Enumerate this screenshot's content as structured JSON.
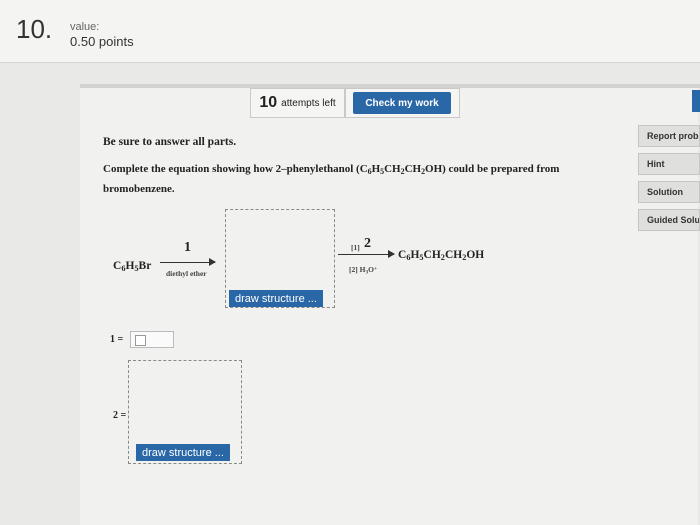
{
  "question": {
    "number": "10.",
    "value_label": "value:",
    "points": "0.50 points"
  },
  "toolbar": {
    "attempts_count": "10",
    "attempts_text": "attempts left",
    "check_label": "Check my work"
  },
  "side": {
    "report": "Report problem",
    "hint": "Hint",
    "solution": "Solution",
    "guided": "Guided Solution"
  },
  "instructions": {
    "line1": "Be sure to answer all parts.",
    "line2_a": "Complete the equation showing how 2–phenylethanol (C",
    "line2_b": "H",
    "line2_c": "CH",
    "line2_d": "CH",
    "line2_e": "OH) could be prepared from bromobenzene."
  },
  "reaction": {
    "reactant_c": "C",
    "reactant_h": "H",
    "reactant_br": "Br",
    "sub6": "6",
    "sub5": "5",
    "sub2": "2",
    "sub3": "3",
    "step1_number": "1",
    "step1_condition": "diethyl ether",
    "step2_label": "[1]",
    "step2_number": "2",
    "step2_cond_a": "[2] H",
    "step2_cond_b": "O",
    "step2_cond_sup": "+",
    "product_a": "C",
    "product_b": "H",
    "product_c": "CH",
    "product_d": "CH",
    "product_e": "OH"
  },
  "answers": {
    "label1": "1 =",
    "label2": "2 =",
    "draw_label": "draw structure ..."
  }
}
